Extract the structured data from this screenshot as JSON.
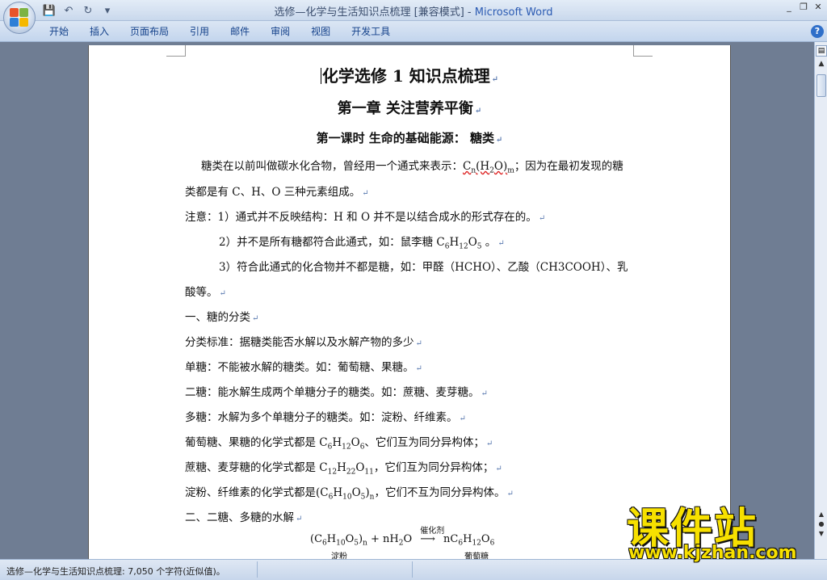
{
  "window": {
    "title": "选修—化学与生活知识点梳理 [兼容模式] - ",
    "app_name": "Microsoft Word",
    "min": "_",
    "restore": "❐",
    "close": "✕"
  },
  "qat": {
    "save": "💾",
    "undo": "↶",
    "redo": "↻",
    "customize": "▾"
  },
  "ribbon": {
    "tabs": [
      "开始",
      "插入",
      "页面布局",
      "引用",
      "邮件",
      "审阅",
      "视图",
      "开发工具"
    ],
    "help": "?"
  },
  "doc": {
    "title": "化学选修 1 知识点梳理",
    "chapter": "第一章  关注营养平衡",
    "lesson": "第一课时      生命的基础能源：  糖类",
    "para1_a": "糖类在以前叫做碳水化合物，曾经用一个通式来表示：",
    "para1_formula": "Cn(H2O)m",
    "para1_b": "；因为在最初发现的糖",
    "para1_line2": "类都是有 C、H、O 三种元素组成。",
    "note1": "注意：1）通式并不反映结构：H 和 O 并不是以结合成水的形式存在的。",
    "note2_a": "2）并不是所有糖都符合此通式，如：鼠李糖 ",
    "note2_formula": "C6H12O5",
    "note3": "3）符合此通式的化合物并不都是糖，如：甲醛（HCHO）、乙酸（CH3COOH）、乳",
    "note3_line2": "酸等。",
    "sec1": "一、糖的分类",
    "criteria": "分类标准：据糖类能否水解以及水解产物的多少",
    "mono": "单糖：不能被水解的糖类。如：葡萄糖、果糖。",
    "di": "二糖：能水解生成两个单糖分子的糖类。如：蔗糖、麦芽糖。",
    "poly": "多糖：水解为多个单糖分子的糖类。如：淀粉、纤维素。",
    "glucose_a": "葡萄糖、果糖的化学式都是 ",
    "glucose_formula": "C6H12O6",
    "glucose_b": "、它们互为同分异构体；",
    "sucrose_a": "蔗糖、麦芽糖的化学式都是 ",
    "sucrose_formula": "C12H22O11",
    "sucrose_b": "，它们互为同分异构体；",
    "starch_a": "淀粉、纤维素的化学式都是",
    "starch_formula": "(C6H10O5)n",
    "starch_b": "，它们不互为同分异构体。",
    "sec2": "二、二糖、多糖的水解",
    "eq_left": "(C6H10O5)n + nH2O",
    "eq_catalyst": "催化剂",
    "eq_right": "nC6H12O6",
    "eq_left_label": "淀粉",
    "eq_right_label": "葡萄糖",
    "para_mark": "↵"
  },
  "status": {
    "text": "选修—化学与生活知识点梳理: 7,050 个字符(近似值)。"
  },
  "watermark": {
    "cn": "课件站",
    "url": "www.kjzhan.com"
  },
  "colors": {
    "ribbon_text": "#15428b",
    "watermark": "#f7e000",
    "app_title": "#2b5bb3"
  }
}
